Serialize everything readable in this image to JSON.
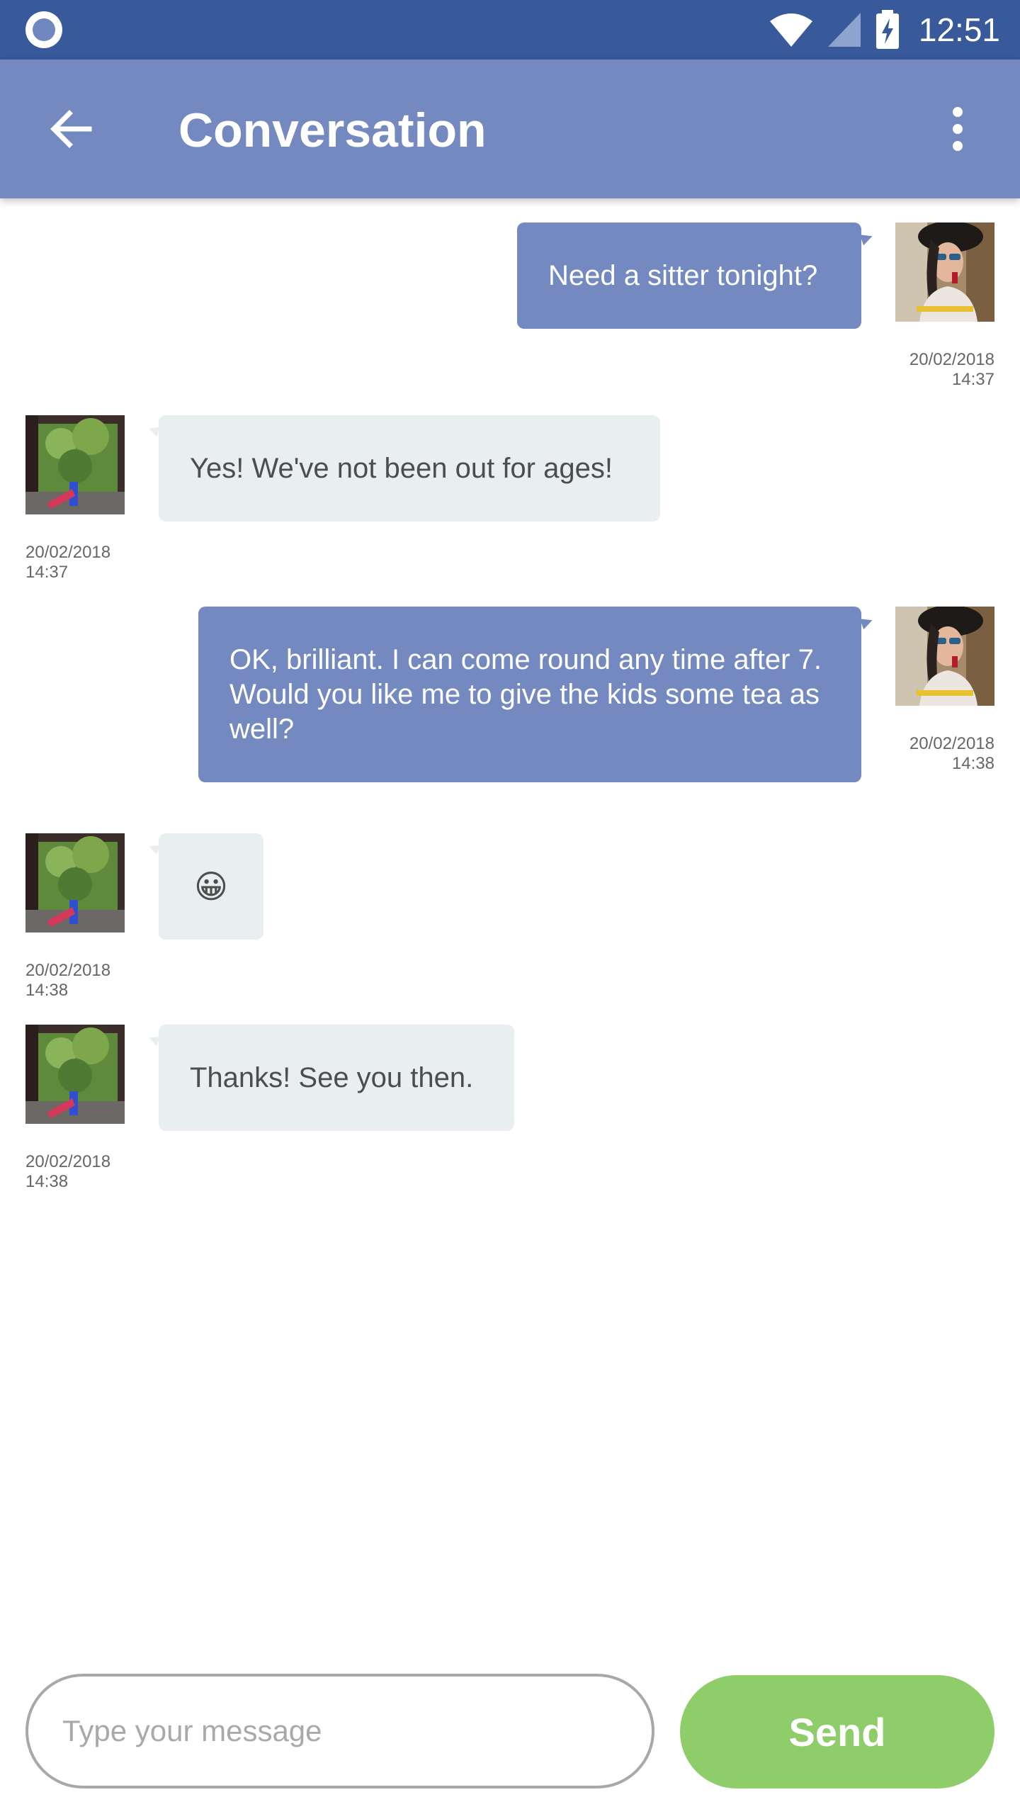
{
  "status_bar": {
    "time": "12:51",
    "icons": [
      "record-icon",
      "wifi-icon",
      "signal-icon",
      "battery-charging-icon"
    ]
  },
  "app_bar": {
    "title": "Conversation",
    "back_icon": "arrow-left-icon",
    "menu_icon": "more-vertical-icon"
  },
  "messages": [
    {
      "direction": "outgoing",
      "text": "Need a sitter tonight?",
      "date": "20/02/2018",
      "time": "14:37"
    },
    {
      "direction": "incoming",
      "text": "Yes! We've not been out for ages!",
      "date": "20/02/2018",
      "time": "14:37"
    },
    {
      "direction": "outgoing",
      "text": "OK, brilliant. I can come round any time after 7. Would you like me to give the kids some tea as well?",
      "date": "20/02/2018",
      "time": "14:38"
    },
    {
      "direction": "incoming",
      "text": "😀",
      "date": "20/02/2018",
      "time": "14:38"
    },
    {
      "direction": "incoming",
      "text": "Thanks! See you then.",
      "date": "20/02/2018",
      "time": "14:38"
    }
  ],
  "composer": {
    "placeholder": "Type your message",
    "value": "",
    "send_label": "Send"
  },
  "colors": {
    "status_bar": "#38599a",
    "app_bar": "#7489bf",
    "outgoing_bubble": "#7489bf",
    "incoming_bubble": "#e9eef0",
    "send_button": "#8ecd6a"
  }
}
